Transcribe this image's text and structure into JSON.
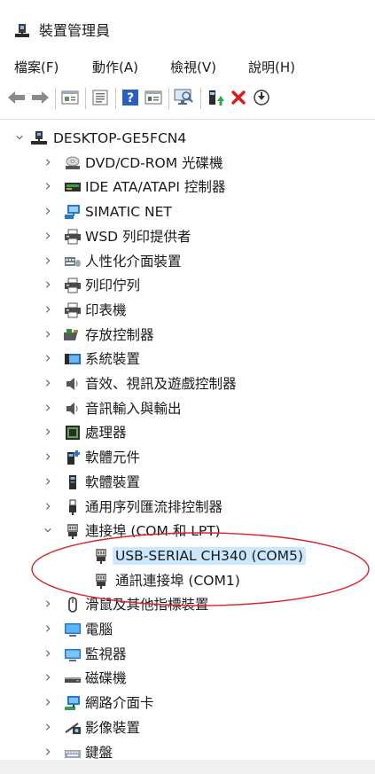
{
  "window": {
    "title": "裝置管理員"
  },
  "menu": [
    "檔案(F)",
    "動作(A)",
    "檢視(V)",
    "說明(H)"
  ],
  "toolbar": [
    {
      "name": "back-icon"
    },
    {
      "name": "forward-icon"
    },
    {
      "name": "properties-icon"
    },
    {
      "name": "update-view-icon"
    },
    {
      "name": "help-icon"
    },
    {
      "name": "show-hidden-icon"
    },
    {
      "name": "scan-hardware-icon"
    },
    {
      "name": "update-driver-icon"
    },
    {
      "name": "uninstall-icon"
    },
    {
      "name": "disable-icon"
    }
  ],
  "tree": {
    "root": "DESKTOP-GE5FCN4",
    "nodes": [
      {
        "label": "DVD/CD-ROM 光碟機",
        "icon": "dvd-drive-icon"
      },
      {
        "label": "IDE ATA/ATAPI 控制器",
        "icon": "ide-controller-icon"
      },
      {
        "label": "SIMATIC NET",
        "icon": "network-device-icon"
      },
      {
        "label": "WSD 列印提供者",
        "icon": "printer-icon"
      },
      {
        "label": "人性化介面裝置",
        "icon": "hid-icon"
      },
      {
        "label": "列印佇列",
        "icon": "printer-icon"
      },
      {
        "label": "印表機",
        "icon": "printer-icon"
      },
      {
        "label": "存放控制器",
        "icon": "storage-controller-icon"
      },
      {
        "label": "系統裝置",
        "icon": "system-device-icon"
      },
      {
        "label": "音效、視訊及遊戲控制器",
        "icon": "speaker-icon"
      },
      {
        "label": "音訊輸入與輸出",
        "icon": "speaker-icon"
      },
      {
        "label": "處理器",
        "icon": "processor-icon"
      },
      {
        "label": "軟體元件",
        "icon": "software-component-icon"
      },
      {
        "label": "軟體裝置",
        "icon": "software-device-icon"
      },
      {
        "label": "通用序列匯流排控制器",
        "icon": "usb-icon"
      },
      {
        "label": "連接埠 (COM 和 LPT)",
        "icon": "port-icon",
        "expanded": true,
        "children": [
          {
            "label": "USB-SERIAL CH340 (COM5)",
            "icon": "port-icon",
            "selected": true
          },
          {
            "label": "通訊連接埠 (COM1)",
            "icon": "port-icon"
          }
        ]
      },
      {
        "label": "滑鼠及其他指標裝置",
        "icon": "mouse-icon"
      },
      {
        "label": "電腦",
        "icon": "computer-icon"
      },
      {
        "label": "監視器",
        "icon": "monitor-icon"
      },
      {
        "label": "磁碟機",
        "icon": "disk-drive-icon"
      },
      {
        "label": "網路介面卡",
        "icon": "network-adapter-icon"
      },
      {
        "label": "影像裝置",
        "icon": "imaging-device-icon"
      },
      {
        "label": "鍵盤",
        "icon": "keyboard-icon"
      }
    ]
  },
  "annotation": {
    "color": "#d9252a"
  },
  "colors": {
    "selection": "#cce8ff",
    "accent": "#0b6bcb"
  }
}
